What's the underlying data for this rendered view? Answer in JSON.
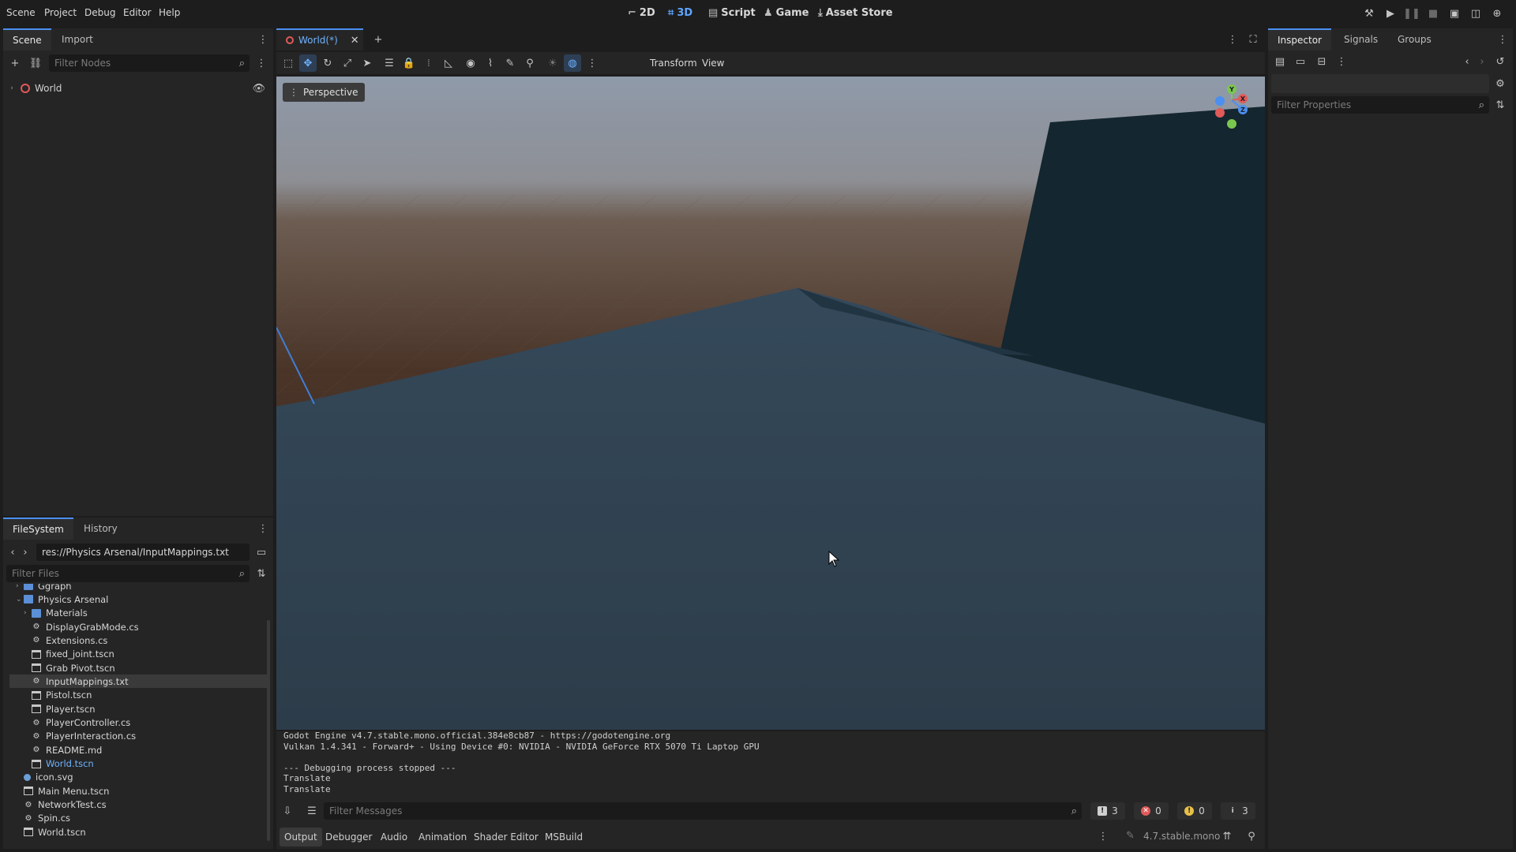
{
  "menu": [
    "Scene",
    "Project",
    "Debug",
    "Editor",
    "Help"
  ],
  "main_tabs": [
    "2D",
    "3D",
    "Script",
    "Game",
    "Asset Store"
  ],
  "scene_panel": {
    "tabs": [
      "Scene",
      "Import"
    ],
    "filter_placeholder": "Filter Nodes",
    "root_node": "World"
  },
  "filesystem": {
    "tabs": [
      "FileSystem",
      "History"
    ],
    "path": "res://Physics Arsenal/InputMappings.txt",
    "filter_placeholder": "Filter Files",
    "items": [
      {
        "name": "Ggraph",
        "type": "folder",
        "depth": 0,
        "arrow": "›"
      },
      {
        "name": "Physics Arsenal",
        "type": "folder",
        "depth": 0,
        "arrow": "⌄"
      },
      {
        "name": "Materials",
        "type": "folder",
        "depth": 1,
        "arrow": "›"
      },
      {
        "name": "DisplayGrabMode.cs",
        "type": "script",
        "depth": 1
      },
      {
        "name": "Extensions.cs",
        "type": "script",
        "depth": 1
      },
      {
        "name": "fixed_joint.tscn",
        "type": "scene",
        "depth": 1
      },
      {
        "name": "Grab Pivot.tscn",
        "type": "scene",
        "depth": 1
      },
      {
        "name": "InputMappings.txt",
        "type": "script",
        "depth": 1,
        "selected": true
      },
      {
        "name": "Pistol.tscn",
        "type": "scene",
        "depth": 1
      },
      {
        "name": "Player.tscn",
        "type": "scene",
        "depth": 1
      },
      {
        "name": "PlayerController.cs",
        "type": "script",
        "depth": 1
      },
      {
        "name": "PlayerInteraction.cs",
        "type": "script",
        "depth": 1
      },
      {
        "name": "README.md",
        "type": "script",
        "depth": 1
      },
      {
        "name": "World.tscn",
        "type": "scene",
        "depth": 1,
        "highlight": true
      },
      {
        "name": "icon.svg",
        "type": "svg",
        "depth": 0
      },
      {
        "name": "Main Menu.tscn",
        "type": "scene",
        "depth": 0
      },
      {
        "name": "NetworkTest.cs",
        "type": "script",
        "depth": 0
      },
      {
        "name": "Spin.cs",
        "type": "script",
        "depth": 0
      },
      {
        "name": "World.tscn",
        "type": "scene",
        "depth": 0
      }
    ]
  },
  "editor_tab": {
    "label": "World(*)"
  },
  "viewport": {
    "toolbar_menus": [
      "Transform",
      "View"
    ],
    "perspective_label": "Perspective",
    "gizmo": {
      "y": "Y",
      "x": "X",
      "z": "Z"
    },
    "colors": {
      "sky_top": "#8f9aa9",
      "ground": "#4a3428",
      "floor": "#2f3f4d",
      "wall": "#14262f"
    }
  },
  "inspector": {
    "tabs": [
      "Inspector",
      "Signals",
      "Groups"
    ],
    "filter_placeholder": "Filter Properties"
  },
  "output": {
    "lines": [
      "Godot Engine v4.7.stable.mono.official.384e8cb87 - https://godotengine.org",
      "Vulkan 1.4.341 - Forward+ - Using Device #0: NVIDIA - NVIDIA GeForce RTX 5070 Ti Laptop GPU",
      "",
      "--- Debugging process stopped ---",
      "Translate",
      "Translate"
    ],
    "filter_placeholder": "Filter Messages",
    "counts": {
      "all": "3",
      "errors": "0",
      "warnings": "0",
      "info": "3"
    }
  },
  "bottom_tabs": [
    "Output",
    "Debugger",
    "Audio",
    "Animation",
    "Shader Editor",
    "MSBuild"
  ],
  "version": "4.7.stable.mono"
}
